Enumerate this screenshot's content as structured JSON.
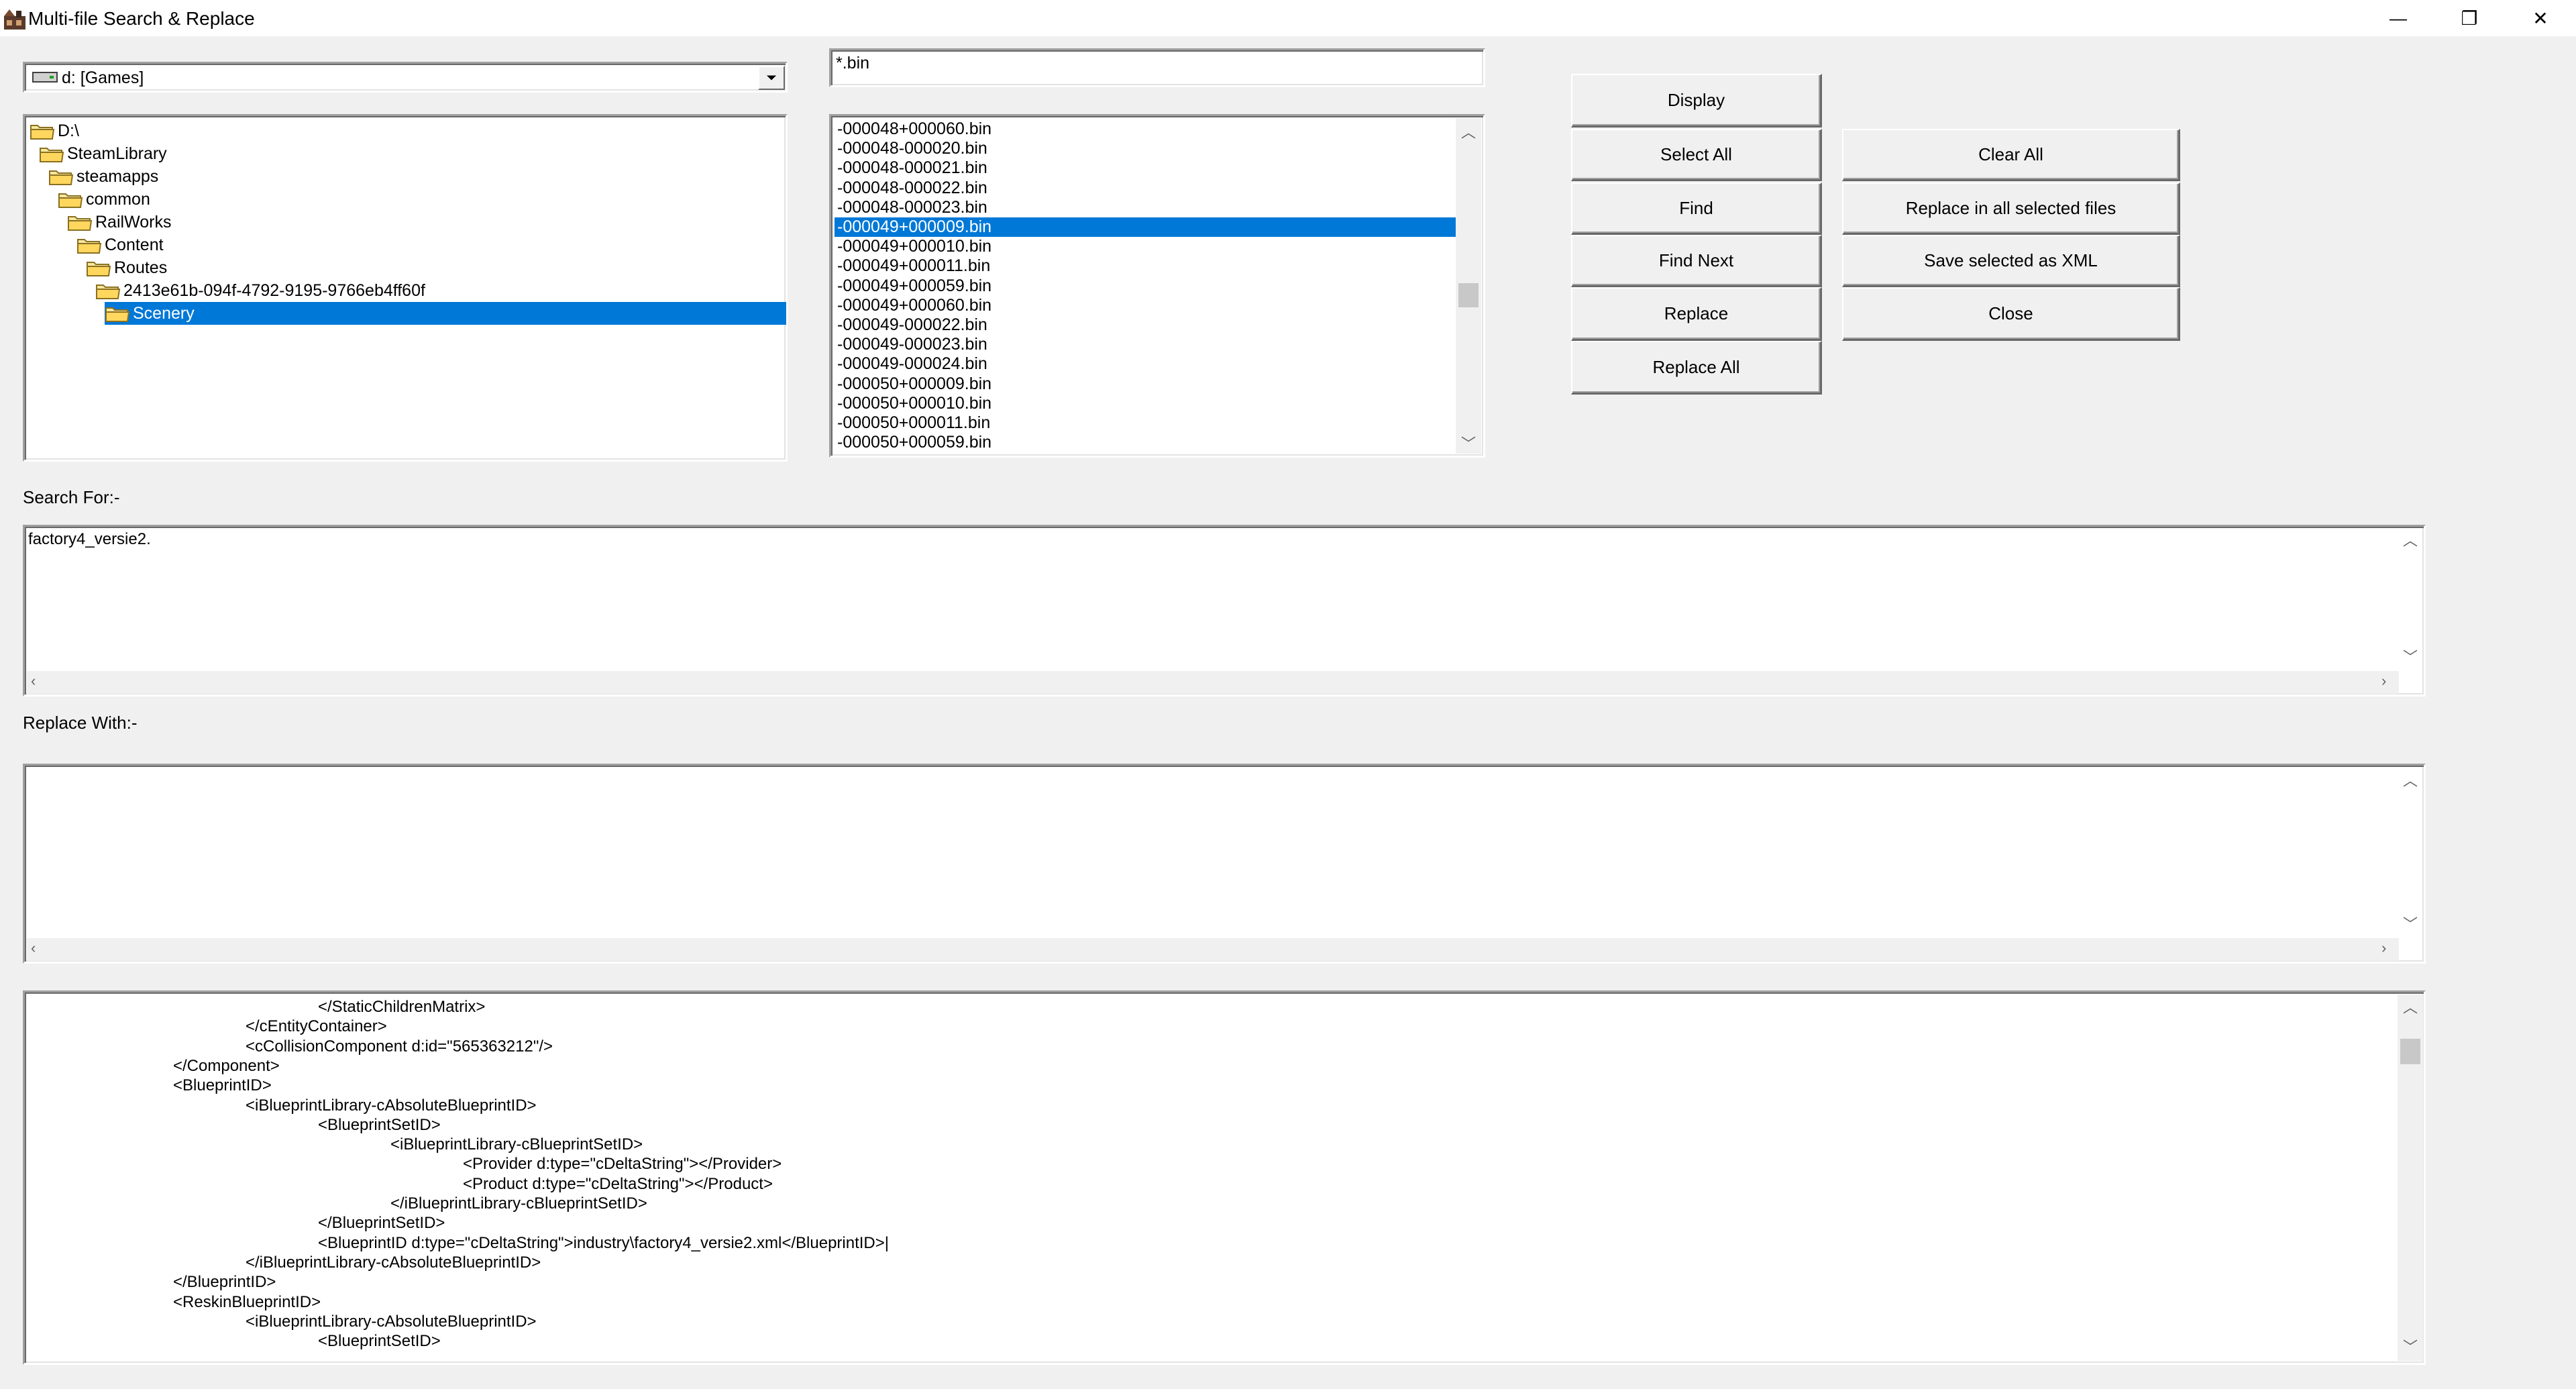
{
  "window": {
    "title": "Multi-file Search & Replace",
    "minimize_glyph": "—",
    "restore_glyph": "❐",
    "close_glyph": "✕"
  },
  "drive": {
    "selected": "d: [Games]"
  },
  "folders": [
    {
      "label": "D:\\",
      "depth": 0
    },
    {
      "label": "SteamLibrary",
      "depth": 1
    },
    {
      "label": "steamapps",
      "depth": 2
    },
    {
      "label": "common",
      "depth": 3
    },
    {
      "label": "RailWorks",
      "depth": 4
    },
    {
      "label": "Content",
      "depth": 5
    },
    {
      "label": "Routes",
      "depth": 6
    },
    {
      "label": "2413e61b-094f-4792-9195-9766eb4ff60f",
      "depth": 7
    },
    {
      "label": "Scenery",
      "depth": 8,
      "selected": true
    }
  ],
  "filter": {
    "value": "*.bin"
  },
  "files": [
    {
      "name": "-000048+000060.bin"
    },
    {
      "name": "-000048-000020.bin"
    },
    {
      "name": "-000048-000021.bin"
    },
    {
      "name": "-000048-000022.bin"
    },
    {
      "name": "-000048-000023.bin"
    },
    {
      "name": "-000049+000009.bin",
      "selected": true
    },
    {
      "name": "-000049+000010.bin"
    },
    {
      "name": "-000049+000011.bin"
    },
    {
      "name": "-000049+000059.bin"
    },
    {
      "name": "-000049+000060.bin"
    },
    {
      "name": "-000049-000022.bin"
    },
    {
      "name": "-000049-000023.bin"
    },
    {
      "name": "-000049-000024.bin"
    },
    {
      "name": "-000050+000009.bin"
    },
    {
      "name": "-000050+000010.bin"
    },
    {
      "name": "-000050+000011.bin"
    },
    {
      "name": "-000050+000059.bin"
    }
  ],
  "buttons": {
    "display": "Display",
    "select_all": "Select All",
    "find": "Find",
    "find_next": "Find Next",
    "replace": "Replace",
    "replace_all": "Replace All",
    "clear_all": "Clear All",
    "replace_in_all_selected": "Replace in all selected files",
    "save_selected_xml": "Save selected as XML",
    "close": "Close"
  },
  "search": {
    "label": "Search For:-",
    "value": "factory4_versie2."
  },
  "replace": {
    "label": "Replace With:-",
    "value": ""
  },
  "output": {
    "lines": [
      {
        "indent": 3,
        "text": "</StaticChildrenMatrix>"
      },
      {
        "indent": 2,
        "text": "</cEntityContainer>"
      },
      {
        "indent": 2,
        "text": "<cCollisionComponent d:id=\"565363212\"/>"
      },
      {
        "indent": 1,
        "text": "</Component>"
      },
      {
        "indent": 1,
        "text": "<BlueprintID>"
      },
      {
        "indent": 2,
        "text": "<iBlueprintLibrary-cAbsoluteBlueprintID>"
      },
      {
        "indent": 3,
        "text": "<BlueprintSetID>"
      },
      {
        "indent": 4,
        "text": "<iBlueprintLibrary-cBlueprintSetID>"
      },
      {
        "indent": 5,
        "text": "<Provider d:type=\"cDeltaString\"></Provider>"
      },
      {
        "indent": 5,
        "text": "<Product d:type=\"cDeltaString\"></Product>"
      },
      {
        "indent": 4,
        "text": "</iBlueprintLibrary-cBlueprintSetID>"
      },
      {
        "indent": 3,
        "text": "</BlueprintSetID>"
      },
      {
        "indent": 3,
        "text": "<BlueprintID d:type=\"cDeltaString\">industry\\factory4_versie2.xml</BlueprintID>|"
      },
      {
        "indent": 2,
        "text": "</iBlueprintLibrary-cAbsoluteBlueprintID>"
      },
      {
        "indent": 1,
        "text": "</BlueprintID>"
      },
      {
        "indent": 1,
        "text": "<ReskinBlueprintID>"
      },
      {
        "indent": 2,
        "text": "<iBlueprintLibrary-cAbsoluteBlueprintID>"
      },
      {
        "indent": 3,
        "text": "<BlueprintSetID>"
      }
    ]
  },
  "icons": {
    "app": "app-icon",
    "drive": "drive-icon",
    "folder": "folder-icon",
    "dropdown": "chevron-down-icon"
  }
}
